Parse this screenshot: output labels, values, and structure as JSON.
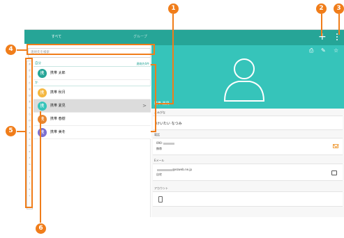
{
  "tabs": {
    "all": "すべて",
    "group": "グループ"
  },
  "toolbar": {
    "add_icon": "plus-icon",
    "more_icon": "overflow-menu-icon"
  },
  "search": {
    "placeholder": "連絡先を検索"
  },
  "index_letters": [
    "あ",
    "か",
    "さ",
    "た",
    "な",
    "は",
    "ま",
    "や",
    "ら",
    "わ",
    "A",
    "B",
    "C",
    "D",
    "E",
    "F",
    "G",
    "H",
    "I",
    "J",
    "K",
    "L"
  ],
  "list": {
    "section_a": {
      "label": "自分",
      "count": "連絡先6件"
    },
    "my_profile": {
      "avatar": "携",
      "name": "携帯 太郎",
      "color": "#26a597"
    },
    "section_ka": {
      "label": "か"
    },
    "contacts": [
      {
        "avatar": "携",
        "name": "携帯 秋月",
        "color": "#f4b740"
      },
      {
        "avatar": "携",
        "name": "携帯 夏見",
        "color": "#36c4ba",
        "selected": true
      },
      {
        "avatar": "携",
        "name": "携帯 春樹",
        "color": "#e8862f"
      },
      {
        "avatar": "携",
        "name": "携帯 美冬",
        "color": "#7b6fd0"
      }
    ],
    "chevron": ">"
  },
  "detail": {
    "header_name": "携帯 夏見",
    "reading_label": "よみがな",
    "reading": "けいたい なつみ",
    "phone_label": "電話",
    "phone_number": "090-",
    "phone_type": "携帯",
    "email_label": "Eメール",
    "email_domain": "@ezweb.ne.jp",
    "email_type": "自宅",
    "account_label": "アカウント",
    "header_icons": [
      "share-icon",
      "edit-icon",
      "star-icon"
    ]
  },
  "callouts": [
    "1",
    "2",
    "3",
    "4",
    "5",
    "6"
  ],
  "colors": {
    "accent": "#26a597",
    "hero": "#36c4ba",
    "callout": "#f07d1a"
  }
}
